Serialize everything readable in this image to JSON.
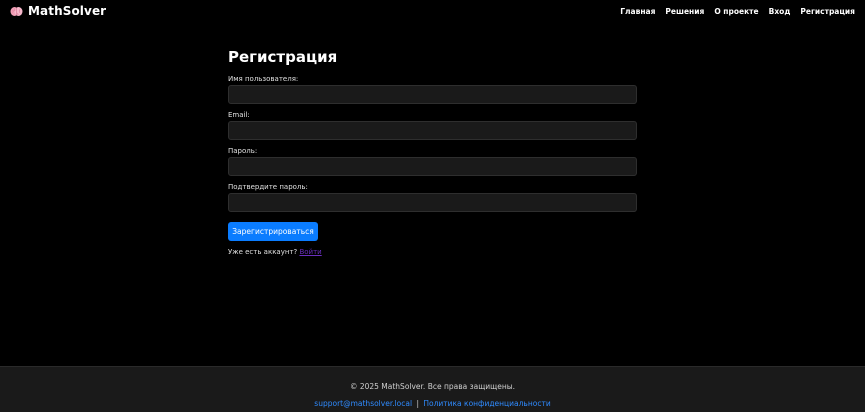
{
  "header": {
    "brand": {
      "icon": "brain-icon",
      "name": "MathSolver"
    },
    "nav": [
      {
        "label": "Главная"
      },
      {
        "label": "Решения"
      },
      {
        "label": "О проекте"
      },
      {
        "label": "Вход"
      },
      {
        "label": "Регистрация"
      }
    ]
  },
  "form": {
    "title": "Регистрация",
    "fields": [
      {
        "label": "Имя пользователя:",
        "value": ""
      },
      {
        "label": "Email:",
        "value": ""
      },
      {
        "label": "Пароль:",
        "value": ""
      },
      {
        "label": "Подтвердите пароль:",
        "value": ""
      }
    ],
    "submit_label": "Зарегистрироваться",
    "login_prompt": "Уже есть аккаунт?",
    "login_link": "Войти"
  },
  "footer": {
    "copyright": "© 2025 MathSolver. Все права защищены.",
    "email": "support@mathsolver.local",
    "separator": "|",
    "privacy": "Политика конфиденциальности"
  },
  "colors": {
    "background": "#000000",
    "accent": "#0a7cff",
    "link": "#2f8bff",
    "visited_link": "#6a2fbf",
    "footer_bg": "#1a1a1a",
    "brand_icon": "#f2a0b8"
  }
}
